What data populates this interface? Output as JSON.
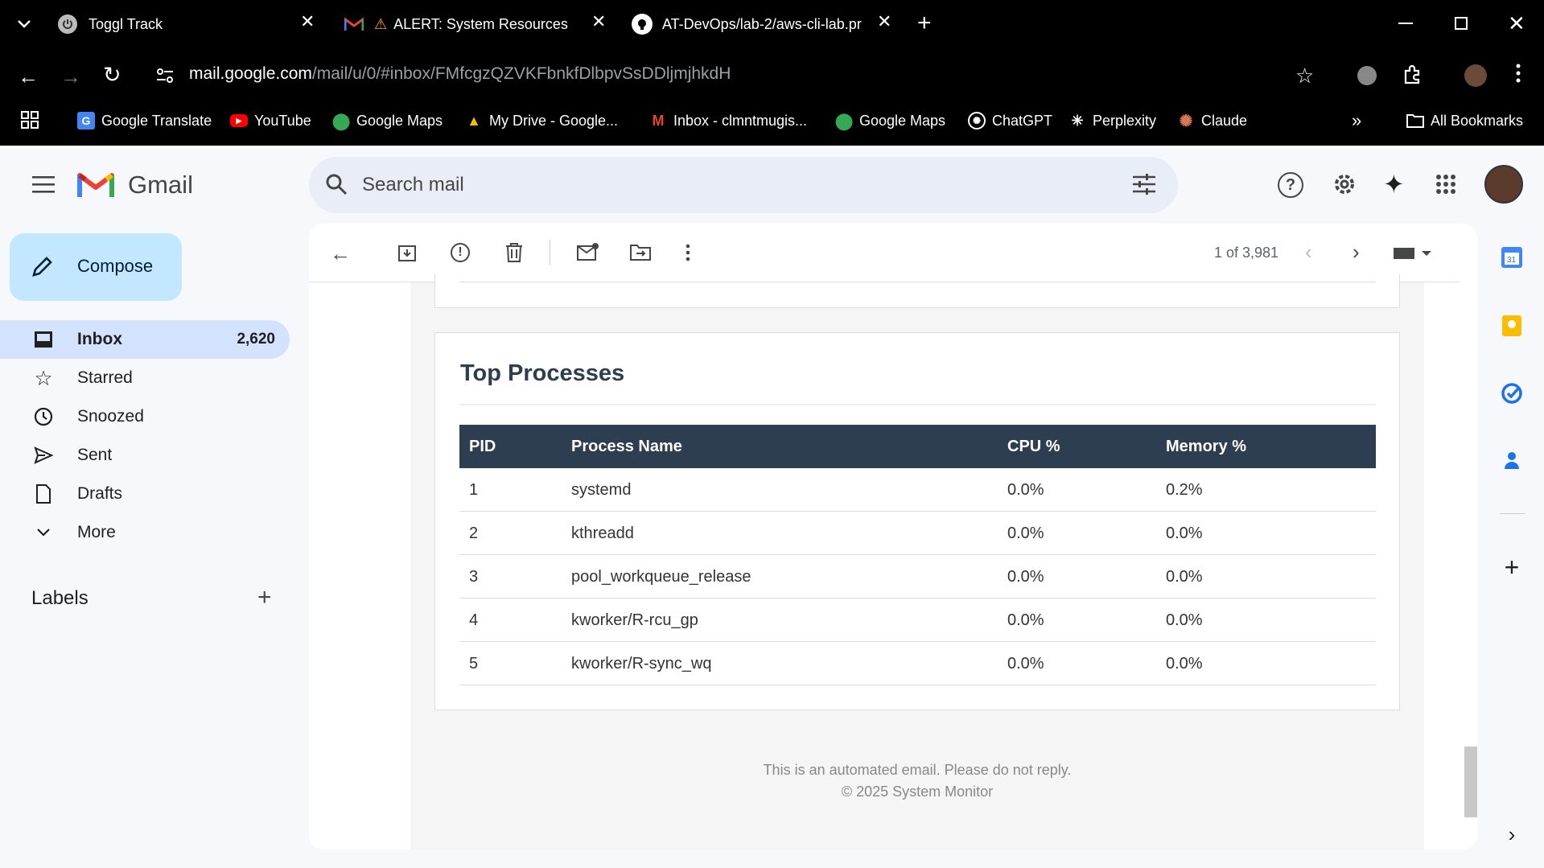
{
  "browser": {
    "tabs": [
      {
        "title": "Toggl Track",
        "icon": "power-icon"
      },
      {
        "title": "ALERT: System Resources Cr",
        "icon": "gmail-icon"
      },
      {
        "title": "AT-DevOps/lab-2/aws-cli-lab.pr",
        "icon": "github-icon"
      }
    ],
    "url_host": "mail.google.com",
    "url_path": "/mail/u/0/#inbox/FMfcgzQZVKFbnkfDlbpvSsDDljmjhkdH",
    "bookmarks": [
      "Google Translate",
      "YouTube",
      "Google Maps",
      "My Drive - Google...",
      "Inbox - clmntmugis...",
      "Google Maps",
      "ChatGPT",
      "Perplexity",
      "Claude"
    ],
    "all_bookmarks": "All Bookmarks"
  },
  "gmail": {
    "logo": "Gmail",
    "search_placeholder": "Search mail",
    "compose": "Compose",
    "nav": [
      {
        "label": "Inbox",
        "count": "2,620",
        "icon": "inbox-icon"
      },
      {
        "label": "Starred",
        "icon": "star-icon"
      },
      {
        "label": "Snoozed",
        "icon": "clock-icon"
      },
      {
        "label": "Sent",
        "icon": "send-icon"
      },
      {
        "label": "Drafts",
        "icon": "draft-icon"
      },
      {
        "label": "More",
        "icon": "chevron-down-icon"
      }
    ],
    "labels_heading": "Labels",
    "pagination": "1 of 3,981"
  },
  "email": {
    "section_title": "Top Processes",
    "table": {
      "headers": [
        "PID",
        "Process Name",
        "CPU %",
        "Memory %"
      ],
      "rows": [
        [
          "1",
          "systemd",
          "0.0%",
          "0.2%"
        ],
        [
          "2",
          "kthreadd",
          "0.0%",
          "0.0%"
        ],
        [
          "3",
          "pool_workqueue_release",
          "0.0%",
          "0.0%"
        ],
        [
          "4",
          "kworker/R-rcu_gp",
          "0.0%",
          "0.0%"
        ],
        [
          "5",
          "kworker/R-sync_wq",
          "0.0%",
          "0.0%"
        ]
      ]
    },
    "footer_line1": "This is an automated email. Please do not reply.",
    "footer_line2": "© 2025 System Monitor"
  },
  "colors": {
    "table_header": "#2c3e50",
    "compose_bg": "#c2e7ff",
    "active_nav": "#d3e3fd"
  }
}
